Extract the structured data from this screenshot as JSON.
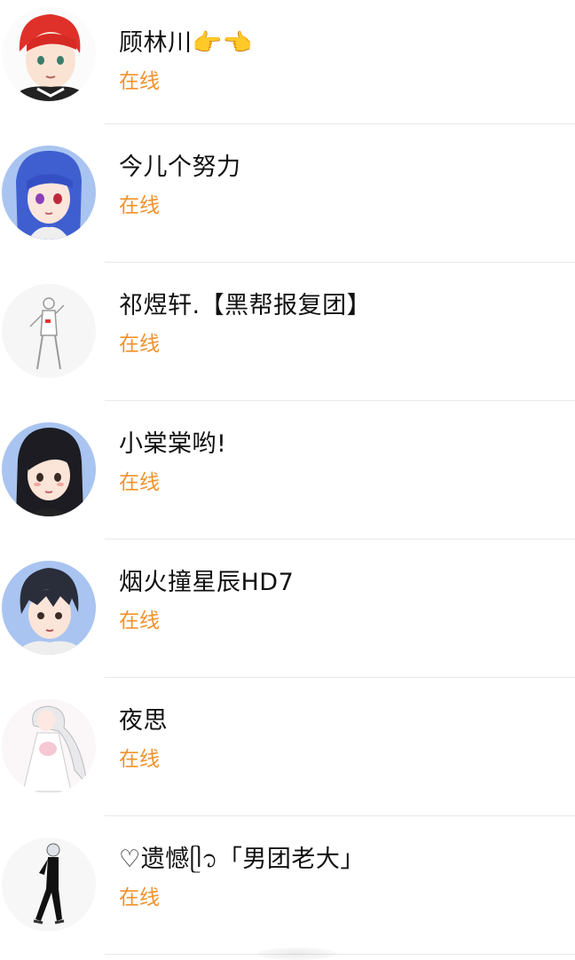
{
  "friends": [
    {
      "name": "顾林川👉👈",
      "status": "在线",
      "avatar": "red-hair-boy-avatar-icon"
    },
    {
      "name": "今儿个努力",
      "status": "在线",
      "avatar": "blue-hair-girl-avatar-icon"
    },
    {
      "name": "祁煜轩.【黑帮报复团】",
      "status": "在线",
      "avatar": "sketch-figure-avatar-icon"
    },
    {
      "name": "小棠棠哟!",
      "status": "在线",
      "avatar": "black-hair-girl-avatar-icon"
    },
    {
      "name": "烟火撞星辰HD7",
      "status": "在线",
      "avatar": "dark-hair-boy-avatar-icon"
    },
    {
      "name": "夜思",
      "status": "在线",
      "avatar": "white-dress-girl-avatar-icon"
    },
    {
      "name": "♡遗憾ᥫ᭡「男团老大」",
      "status": "在线",
      "avatar": "black-suit-figure-avatar-icon"
    }
  ],
  "colors": {
    "status": "#f0922c",
    "divider": "#e9e9e9",
    "name": "#111111"
  }
}
